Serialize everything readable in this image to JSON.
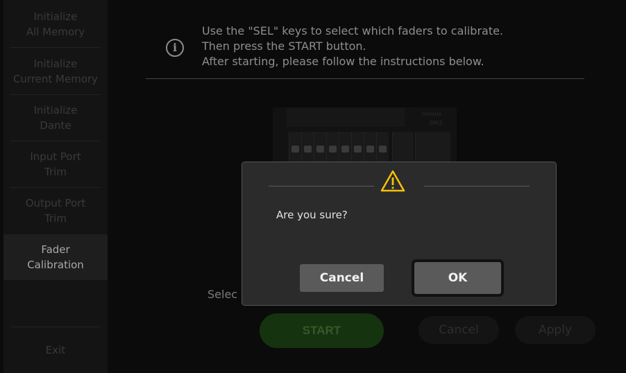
{
  "sidebar": {
    "items": [
      {
        "label": "Initialize\nAll Memory"
      },
      {
        "label": "Initialize\nCurrent Memory"
      },
      {
        "label": "Initialize\nDante"
      },
      {
        "label": "Input Port\nTrim"
      },
      {
        "label": "Output Port\nTrim"
      },
      {
        "label": "Fader\nCalibration"
      },
      {
        "label": ""
      },
      {
        "label": "Exit"
      }
    ]
  },
  "main": {
    "instructions": "Use the \"SEL\" keys to select which faders to calibrate.\nThen press the START button.\nAfter starting, please follow the instructions below.",
    "info_icon_glyph": "i",
    "select_text": "Selec",
    "console": {
      "brand": "YAMAHA",
      "model": "DM3"
    },
    "start_label": "START",
    "cancel_label": "Cancel",
    "apply_label": "Apply"
  },
  "dialog": {
    "message": "Are you sure?",
    "cancel_label": "Cancel",
    "ok_label": "OK",
    "warning_color": "#f5c20a"
  }
}
